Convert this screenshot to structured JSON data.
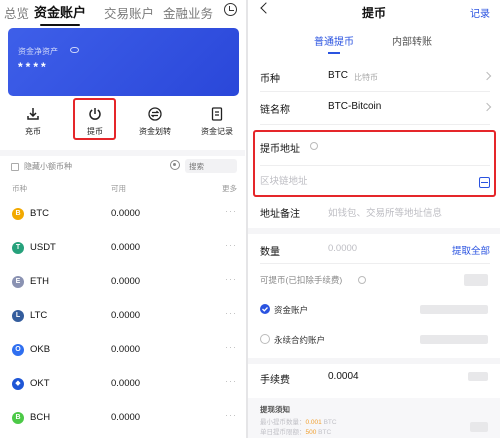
{
  "left": {
    "top_tabs": [
      {
        "label": "总览",
        "active": false
      },
      {
        "label": "资金账户",
        "active": true
      },
      {
        "label": "交易账户",
        "active": false
      },
      {
        "label": "金融业务",
        "active": false
      }
    ],
    "card": {
      "label": "资金净资产",
      "value": "****",
      "color": "#3358e6"
    },
    "actions": [
      {
        "label": "充币",
        "icon": "deposit-icon"
      },
      {
        "label": "提币",
        "icon": "withdraw-icon",
        "highlighted": true
      },
      {
        "label": "资金划转",
        "icon": "transfer-icon"
      },
      {
        "label": "资金记录",
        "icon": "record-icon"
      }
    ],
    "filter": {
      "hide_small_label": "隐藏小额币种",
      "search_placeholder": "搜索"
    },
    "table_headers": {
      "coin": "币种",
      "available": "可用",
      "more": "更多"
    },
    "coins": [
      {
        "symbol": "BTC",
        "amount": "0.0000",
        "color": "#f2a900",
        "glyph": "B"
      },
      {
        "symbol": "USDT",
        "amount": "0.0000",
        "color": "#26a17b",
        "glyph": "T"
      },
      {
        "symbol": "ETH",
        "amount": "0.0000",
        "color": "#8a92b2",
        "glyph": "E"
      },
      {
        "symbol": "LTC",
        "amount": "0.0000",
        "color": "#345d9d",
        "glyph": "L"
      },
      {
        "symbol": "OKB",
        "amount": "0.0000",
        "color": "#2f6ff0",
        "glyph": "O"
      },
      {
        "symbol": "OKT",
        "amount": "0.0000",
        "color": "#1e56d6",
        "glyph": "◆"
      },
      {
        "symbol": "BCH",
        "amount": "0.0000",
        "color": "#4cc947",
        "glyph": "B"
      }
    ],
    "more_glyph": "···"
  },
  "right": {
    "header": {
      "title": "提币",
      "records": "记录"
    },
    "tabs": [
      {
        "label": "普通提币",
        "active": true
      },
      {
        "label": "内部转账",
        "active": false
      }
    ],
    "coin_field": {
      "label": "币种",
      "value": "BTC",
      "sub": "比特币"
    },
    "chain_field": {
      "label": "链名称",
      "value": "BTC-Bitcoin"
    },
    "address_field": {
      "label": "提币地址",
      "placeholder": "区块链地址"
    },
    "memo_field": {
      "label": "地址备注",
      "placeholder": "如钱包、交易所等地址信息"
    },
    "amount_field": {
      "label": "数量",
      "placeholder": "0.0000",
      "action": "提取全部"
    },
    "withdrawable_label": "可提币(已扣除手续费)",
    "accounts": [
      {
        "label": "资金账户",
        "selected": true
      },
      {
        "label": "永续合约账户",
        "selected": false
      }
    ],
    "fee_field": {
      "label": "手续费",
      "value": "0.0004"
    },
    "notes": {
      "title": "提现须知",
      "line1_prefix": "最小提币数量：",
      "line1_value": "0.001",
      "line1_unit": "BTC",
      "line2_prefix": "单日提币限额：",
      "line2_value": "500",
      "line2_unit": "BTC"
    },
    "accent_color": "#2a53e0"
  }
}
